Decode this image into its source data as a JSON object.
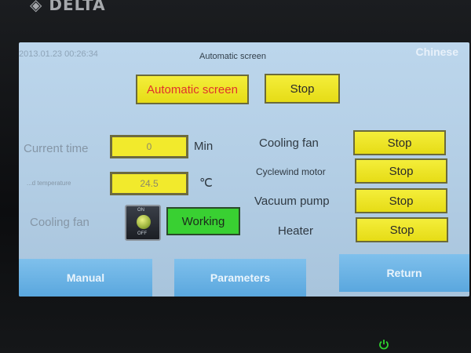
{
  "device": {
    "brand": "◈ DELTA"
  },
  "header": {
    "datetime": "2013.01.23   00:26:34",
    "title": "Automatic screen",
    "language": "Chinese"
  },
  "top_buttons": {
    "automatic": "Automatic screen",
    "stop": "Stop"
  },
  "left_panel": {
    "current_time_label": "Current time",
    "current_time_value": "0",
    "current_time_unit": "Min",
    "temperature_label": "...d temperature",
    "temperature_value": "24.5",
    "temperature_unit": "℃",
    "cooling_fan_label": "Cooling fan",
    "toggle_on": "ON",
    "toggle_off": "OFF",
    "cooling_fan_status": "Working"
  },
  "right_panel": {
    "rows": [
      {
        "label": "Cooling fan",
        "button": "Stop"
      },
      {
        "label": "Cyclewind motor",
        "button": "Stop"
      },
      {
        "label": "Vacuum pump",
        "button": "Stop"
      },
      {
        "label": "Heater",
        "button": "Stop"
      }
    ]
  },
  "bottom_nav": {
    "manual": "Manual",
    "parameters": "Parameters",
    "return": "Return"
  },
  "colors": {
    "screen_bg": "#b8d2e8",
    "button_yellow": "#eee22a",
    "status_green": "#39d032",
    "nav_blue": "#6cb4e6",
    "alert_red": "#e0322c"
  },
  "icons": {
    "power": "power-icon",
    "toggle": "on-off-switch-icon"
  }
}
